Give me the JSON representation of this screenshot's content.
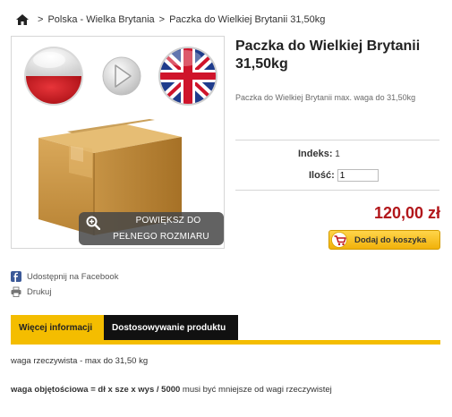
{
  "breadcrumb": {
    "separator": ">",
    "items": [
      "Polska - Wielka Brytania",
      "Paczka do Wielkiej Brytanii 31,50kg"
    ]
  },
  "image": {
    "zoom_line1": "POWIĘKSZ DO",
    "zoom_line2": "PEŁNEGO ROZMIARU"
  },
  "product": {
    "title": "Paczka do Wielkiej Brytanii 31,50kg",
    "short_description": "Paczka do Wielkiej Brytanii max. waga do 31,50kg",
    "reference_label": "Indeks:",
    "reference_value": "1",
    "quantity_label": "Ilość:",
    "quantity_value": "1",
    "price": "120,00 zł",
    "add_to_cart": "Dodaj do koszyka"
  },
  "social": {
    "facebook": "Udostępnij na Facebook",
    "print": "Drukuj"
  },
  "tabs": {
    "more_info": "Więcej informacji",
    "customization": "Dostosowywanie produktu"
  },
  "description": {
    "line1": "waga rzeczywista - max do 31,50 kg",
    "line2_bold": "waga objętościowa = dł x sze x wys / 5000",
    "line2_rest": " musi być mniejsze od wagi rzeczywistej"
  },
  "colors": {
    "accent": "#f4bd00",
    "price": "#b2171b",
    "tab_dark": "#111111"
  }
}
